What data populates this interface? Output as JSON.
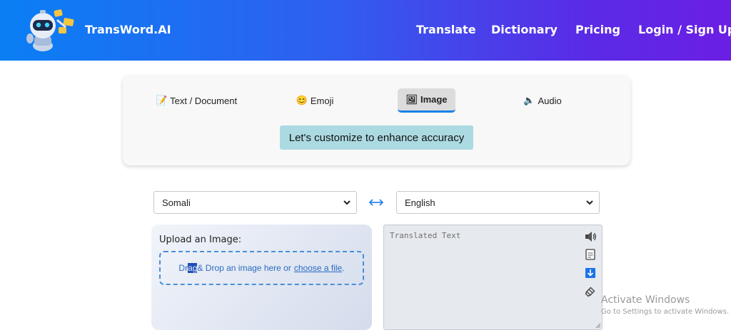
{
  "header": {
    "brand": "TransWord.AI",
    "nav": [
      "Translate",
      "Dictionary",
      "Pricing",
      "Login / Sign Up"
    ]
  },
  "modes": {
    "tabs": [
      {
        "icon": "📝",
        "label": "Text / Document"
      },
      {
        "icon": "😊",
        "label": "Emoji"
      },
      {
        "icon": "🖼",
        "label": "Image"
      },
      {
        "icon": "🔈",
        "label": "Audio"
      }
    ],
    "active": "Image",
    "customize_label": "Let's customize to enhance accuracy"
  },
  "languages": {
    "source": "Somali",
    "target": "English"
  },
  "upload": {
    "title": "Upload an Image:",
    "drop_pre": "Dr",
    "drop_selected": "ag",
    "drop_post": " & Drop an image here or",
    "choose_link": "choose a file",
    "drop_end": "."
  },
  "output": {
    "placeholder": "Translated Text",
    "icons": [
      "speaker-icon",
      "copy-icon",
      "download-icon",
      "share-icon"
    ]
  },
  "watermark": {
    "line1": "Activate Windows",
    "line2": "Go to Settings to activate Windows."
  },
  "colors": {
    "accent": "#1a7fe6",
    "customize_bg": "#acdae2"
  }
}
